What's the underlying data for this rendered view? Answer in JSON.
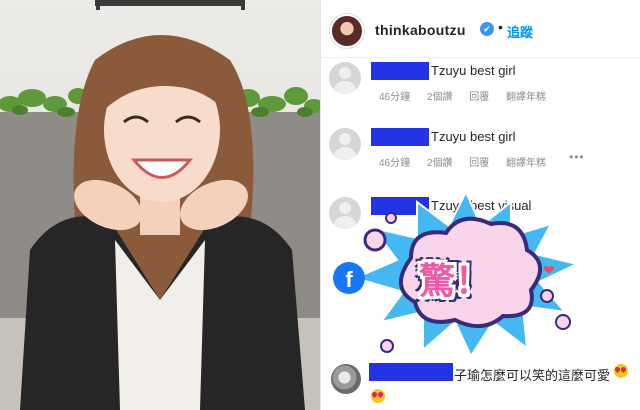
{
  "post_header": {
    "username": "thinkaboutzu",
    "verified_glyph": "✔",
    "separator": "•",
    "follow_label": "追蹤"
  },
  "comments": [
    {
      "text": "Tzuyu best girl",
      "time": "46分鐘",
      "likes": "2個讚",
      "reply": "回覆",
      "translate": "翻譯年糕"
    },
    {
      "text": "Tzuyu best girl",
      "time": "46分鐘",
      "likes": "2個讚",
      "reply": "回覆",
      "translate": "翻譯年糕"
    },
    {
      "text": "Tzuyu best visual"
    }
  ],
  "last_comment": {
    "text": "子瑜怎麼可以笑的這麼可愛"
  },
  "sticker": {
    "label": "驚！"
  },
  "icons": {
    "more": "•••",
    "facebook": "f",
    "heart": "❤"
  },
  "colors": {
    "redaction": "#2234e6",
    "link_blue": "#0095f6",
    "sticker_pink": "#ed5aa8",
    "sticker_blue": "#45b8f2"
  }
}
